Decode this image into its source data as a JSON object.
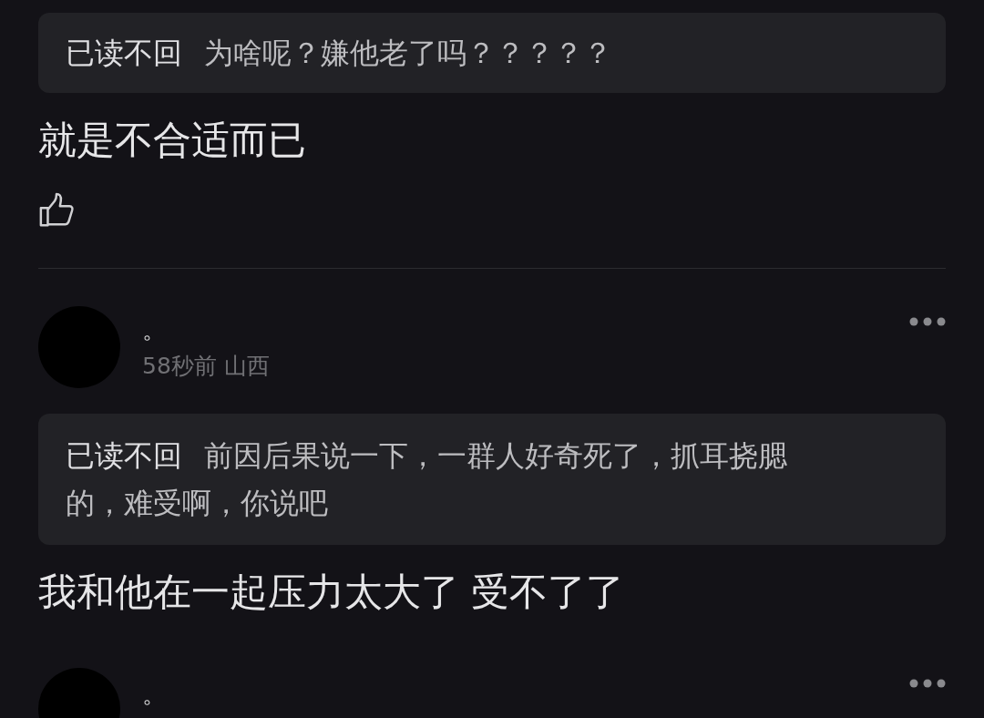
{
  "comments": [
    {
      "quote": {
        "author": "已读不回",
        "text": "为啥呢？嫌他老了吗？？？？？"
      },
      "text": "就是不合适而已",
      "like_button": true
    },
    {
      "header": {
        "name": "。",
        "meta": "58秒前 山西"
      },
      "quote": {
        "author": "已读不回",
        "text": "前因后果说一下，一群人好奇死了，抓耳挠腮的，难受啊，你说吧"
      },
      "text": "我和他在一起压力太大了 受不了了"
    },
    {
      "header": {
        "name": "。"
      }
    }
  ]
}
